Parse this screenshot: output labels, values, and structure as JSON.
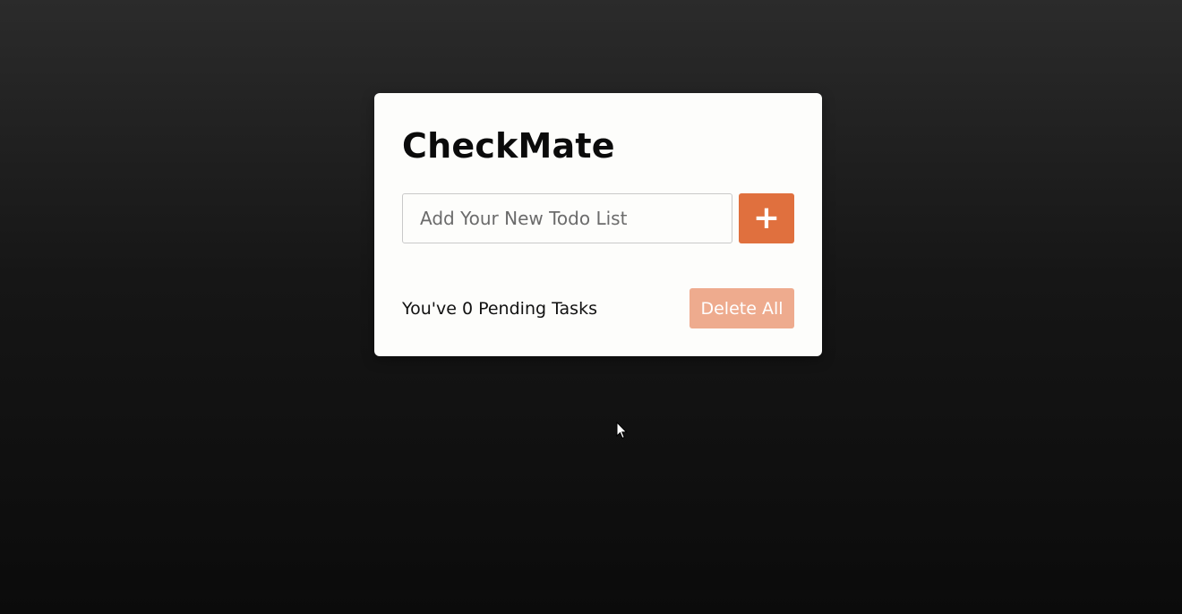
{
  "app": {
    "title": "CheckMate"
  },
  "input": {
    "value": "",
    "placeholder": "Add Your New Todo List"
  },
  "add_button": {
    "label": "+",
    "icon": "plus-icon"
  },
  "footer": {
    "pending_prefix": "You've ",
    "pending_count": "0",
    "pending_suffix": " Pending Tasks",
    "delete_label": "Delete All"
  },
  "colors": {
    "accent": "#e0703e",
    "accent_disabled": "#eeab8e",
    "card": "#fdfdfb"
  }
}
